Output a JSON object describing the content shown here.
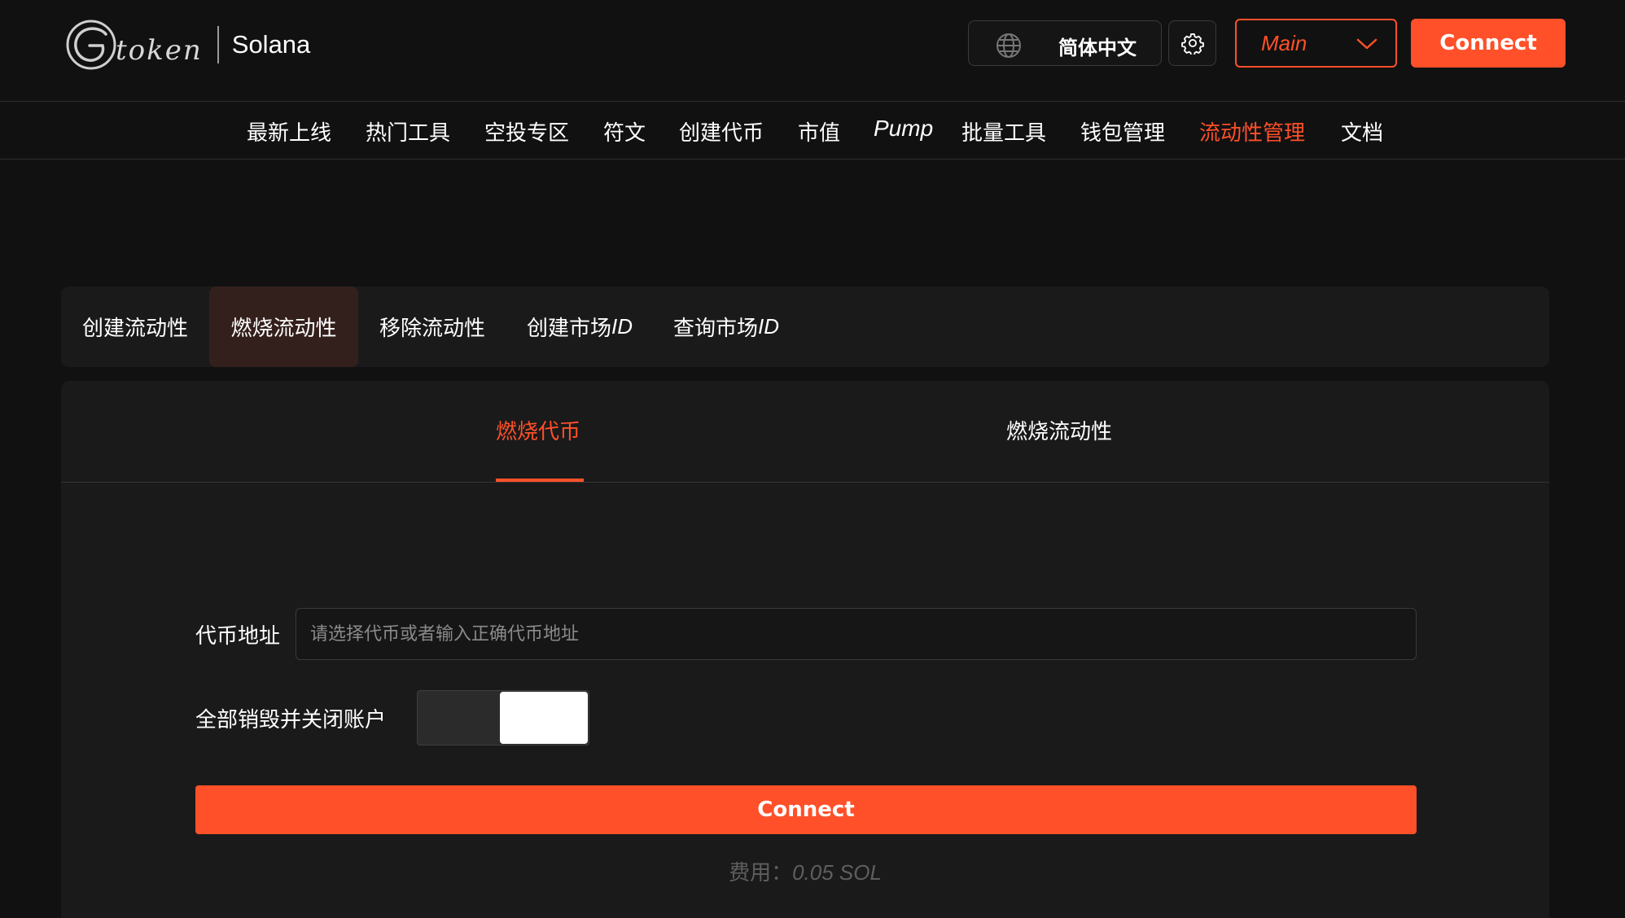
{
  "header": {
    "logo_text": "token",
    "chain_name": "Solana",
    "language": "简体中文",
    "network": "Main",
    "connect_label": "Connect"
  },
  "nav": {
    "items": [
      {
        "label": "最新上线"
      },
      {
        "label": "热门工具"
      },
      {
        "label": "空投专区"
      },
      {
        "label": "符文"
      },
      {
        "label": "创建代币"
      },
      {
        "label": "市值"
      },
      {
        "label": "Pump"
      },
      {
        "label": "批量工具"
      },
      {
        "label": "钱包管理"
      },
      {
        "label": "流动性管理",
        "active": true
      },
      {
        "label": "文档"
      }
    ]
  },
  "tabs": [
    {
      "label": "创建流动性"
    },
    {
      "label": "燃烧流动性",
      "active": true
    },
    {
      "label": "移除流动性"
    },
    {
      "label": "创建市场",
      "suffix": "ID"
    },
    {
      "label": "查询市场",
      "suffix": "ID"
    }
  ],
  "subtabs": [
    {
      "label": "燃烧代币",
      "active": true
    },
    {
      "label": "燃烧流动性"
    }
  ],
  "form": {
    "token_address_label": "代币地址",
    "token_address_placeholder": "请选择代币或者输入正确代币地址",
    "burn_all_label": "全部销毁并关闭账户",
    "connect_label": "Connect",
    "fee_label": "费用：",
    "fee_value": "0.05 SOL"
  },
  "colors": {
    "accent": "#ff5029",
    "background": "#111111",
    "panel": "#1a1a1a",
    "active_tab_bg": "#33201c"
  },
  "icons": {
    "globe": "globe-icon",
    "settings": "gear-icon",
    "dropdown": "chevron-down-icon"
  }
}
